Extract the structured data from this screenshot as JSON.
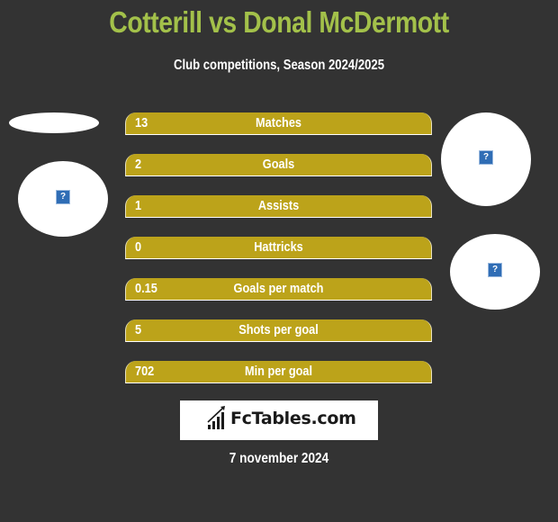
{
  "header": {
    "title": "Cotterill vs Donal McDermott",
    "subtitle": "Club competitions, Season 2024/2025"
  },
  "colors": {
    "background": "#333333",
    "title": "#a3c14a",
    "bar_fill": "#bca31a",
    "text": "#ffffff"
  },
  "player_left": {
    "image_icon": "broken-image-icon"
  },
  "player_right": {
    "image_icon": "broken-image-icon"
  },
  "stats": [
    {
      "value": "13",
      "label": "Matches"
    },
    {
      "value": "2",
      "label": "Goals"
    },
    {
      "value": "1",
      "label": "Assists"
    },
    {
      "value": "0",
      "label": "Hattricks"
    },
    {
      "value": "0.15",
      "label": "Goals per match"
    },
    {
      "value": "5",
      "label": "Shots per goal"
    },
    {
      "value": "702",
      "label": "Min per goal"
    }
  ],
  "logo": {
    "text": "FcTables.com",
    "icon": "bar-chart-icon"
  },
  "footer": {
    "date": "7 november 2024"
  }
}
